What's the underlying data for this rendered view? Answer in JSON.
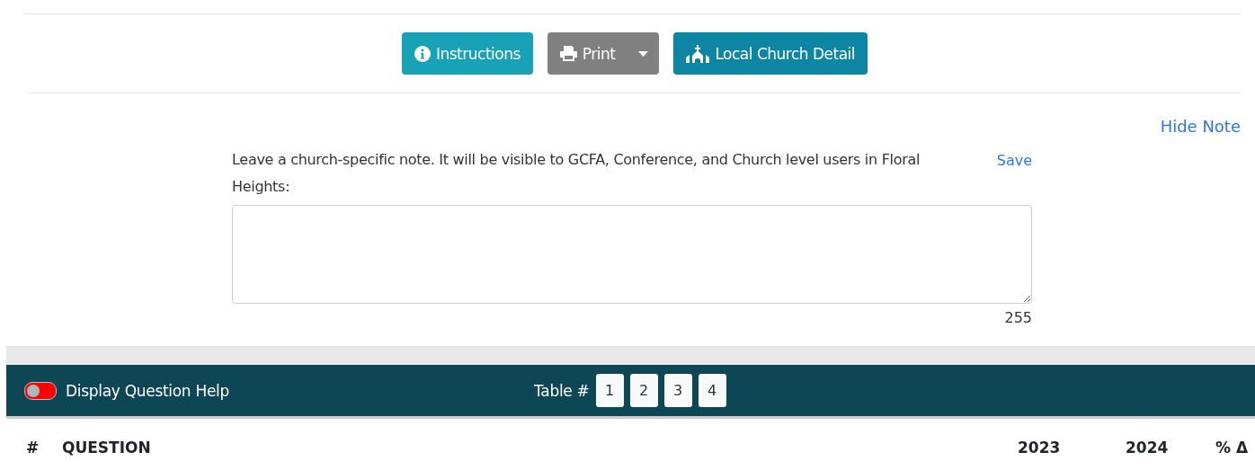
{
  "toolbar": {
    "buttons": [
      {
        "kind": "info",
        "label": "Instructions"
      },
      {
        "kind": "print",
        "label": "Print"
      },
      {
        "kind": "church",
        "label": "Local Church Detail"
      }
    ]
  },
  "note": {
    "toggle_label": "Hide Note",
    "prompt": "Leave a church-specific note. It will be visible to GCFA, Conference, and Church level users in Floral Heights:",
    "save_label": "Save",
    "remaining": "255"
  },
  "question_bar": {
    "help_toggle": {
      "label": "Display Question Help",
      "on": false
    },
    "table_label": "Table #",
    "tables": [
      "1",
      "2",
      "3",
      "4"
    ]
  },
  "table": {
    "columns": [
      "#",
      "QUESTION",
      "2023",
      "2024",
      "% Δ"
    ]
  }
}
